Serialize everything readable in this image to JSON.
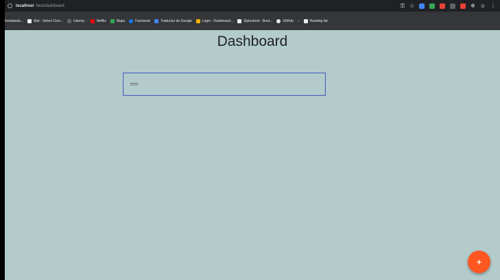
{
  "browser": {
    "host": "localhost",
    "path": "/test/dashboard",
    "bookmarks": [
      {
        "label": "Instalando...",
        "color": "#9aa0a6"
      },
      {
        "label": "Mat - Select Com...",
        "color": "#e8eaed"
      },
      {
        "label": "Udemy -",
        "color": "#5f6368"
      },
      {
        "label": "Netflix",
        "color": "#e50914"
      },
      {
        "label": "Maps",
        "color": "#34a853"
      },
      {
        "label": "Facebook",
        "color": "#1877f2"
      },
      {
        "label": "Traductor de Google",
        "color": "#4285f4"
      },
      {
        "label": "Login - Dashboard...",
        "color": "#f4b400"
      },
      {
        "label": "Stylesheet - Boot...",
        "color": "#e8eaed"
      },
      {
        "label": "GitHub",
        "color": "#e8eaed"
      },
      {
        "label": "Reading list",
        "color": "#e8eaed"
      }
    ],
    "extensions": [
      {
        "name": "key-icon",
        "color": "#9aa0a6"
      },
      {
        "name": "star-icon",
        "color": "#9aa0a6"
      },
      {
        "name": "extension-blue",
        "color": "#4285f4"
      },
      {
        "name": "extension-green",
        "color": "#34a853"
      },
      {
        "name": "extension-red",
        "color": "#ea4335"
      },
      {
        "name": "extension-dark",
        "color": "#5f6368"
      },
      {
        "name": "extension-pink",
        "color": "#ea4335"
      },
      {
        "name": "extension-puzzle",
        "color": "#9aa0a6"
      }
    ]
  },
  "page": {
    "title": "Dashboard",
    "input_value": "test",
    "fab_label": "+"
  },
  "colors": {
    "background": "#b4cbcb",
    "accent": "#ff5722",
    "input_border": "#4a63c0"
  }
}
